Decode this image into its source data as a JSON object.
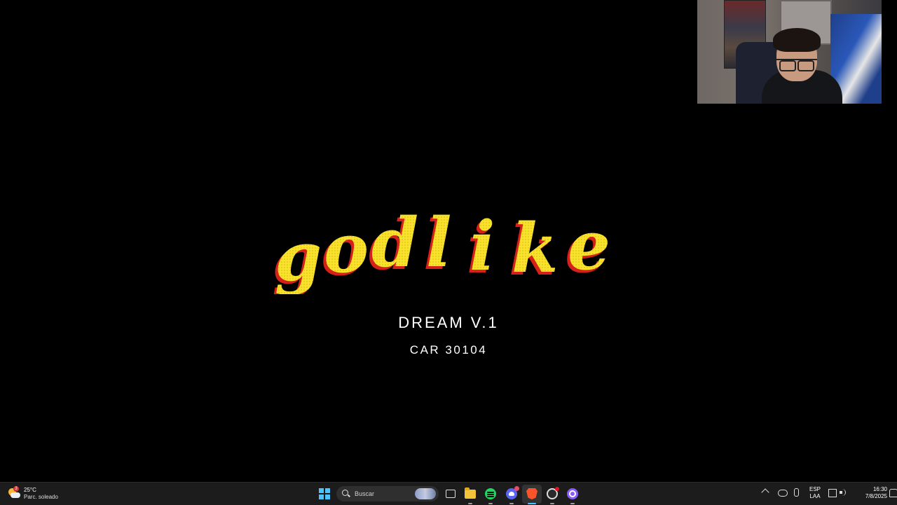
{
  "screen": {
    "logo_text": "godlike",
    "subtitle": "DREAM V.1",
    "code": "CAR 30104",
    "colors": {
      "logo_fill": "#f7e32a",
      "logo_shadow": "#d6201a",
      "background": "#000000"
    }
  },
  "webcam": {
    "icon": "webcam-feed"
  },
  "taskbar": {
    "weather": {
      "temp": "25°C",
      "desc": "Parc. soleado",
      "badge": "3",
      "icon": "partly-sunny-icon"
    },
    "start_icon": "windows-start-icon",
    "search_placeholder": "Buscar",
    "pinned": [
      {
        "name": "task-view",
        "icon": "task-view-icon"
      },
      {
        "name": "file-explorer",
        "icon": "folder-icon"
      },
      {
        "name": "spotify",
        "icon": "spotify-icon"
      },
      {
        "name": "discord",
        "icon": "discord-icon"
      },
      {
        "name": "brave",
        "icon": "brave-icon",
        "active": true
      },
      {
        "name": "obs",
        "icon": "obs-icon"
      },
      {
        "name": "app",
        "icon": "circle-app-icon"
      }
    ],
    "tray": {
      "lang_line1": "ESP",
      "lang_line2": "LAA",
      "time": "16:30",
      "date": "7/8/2025"
    }
  }
}
